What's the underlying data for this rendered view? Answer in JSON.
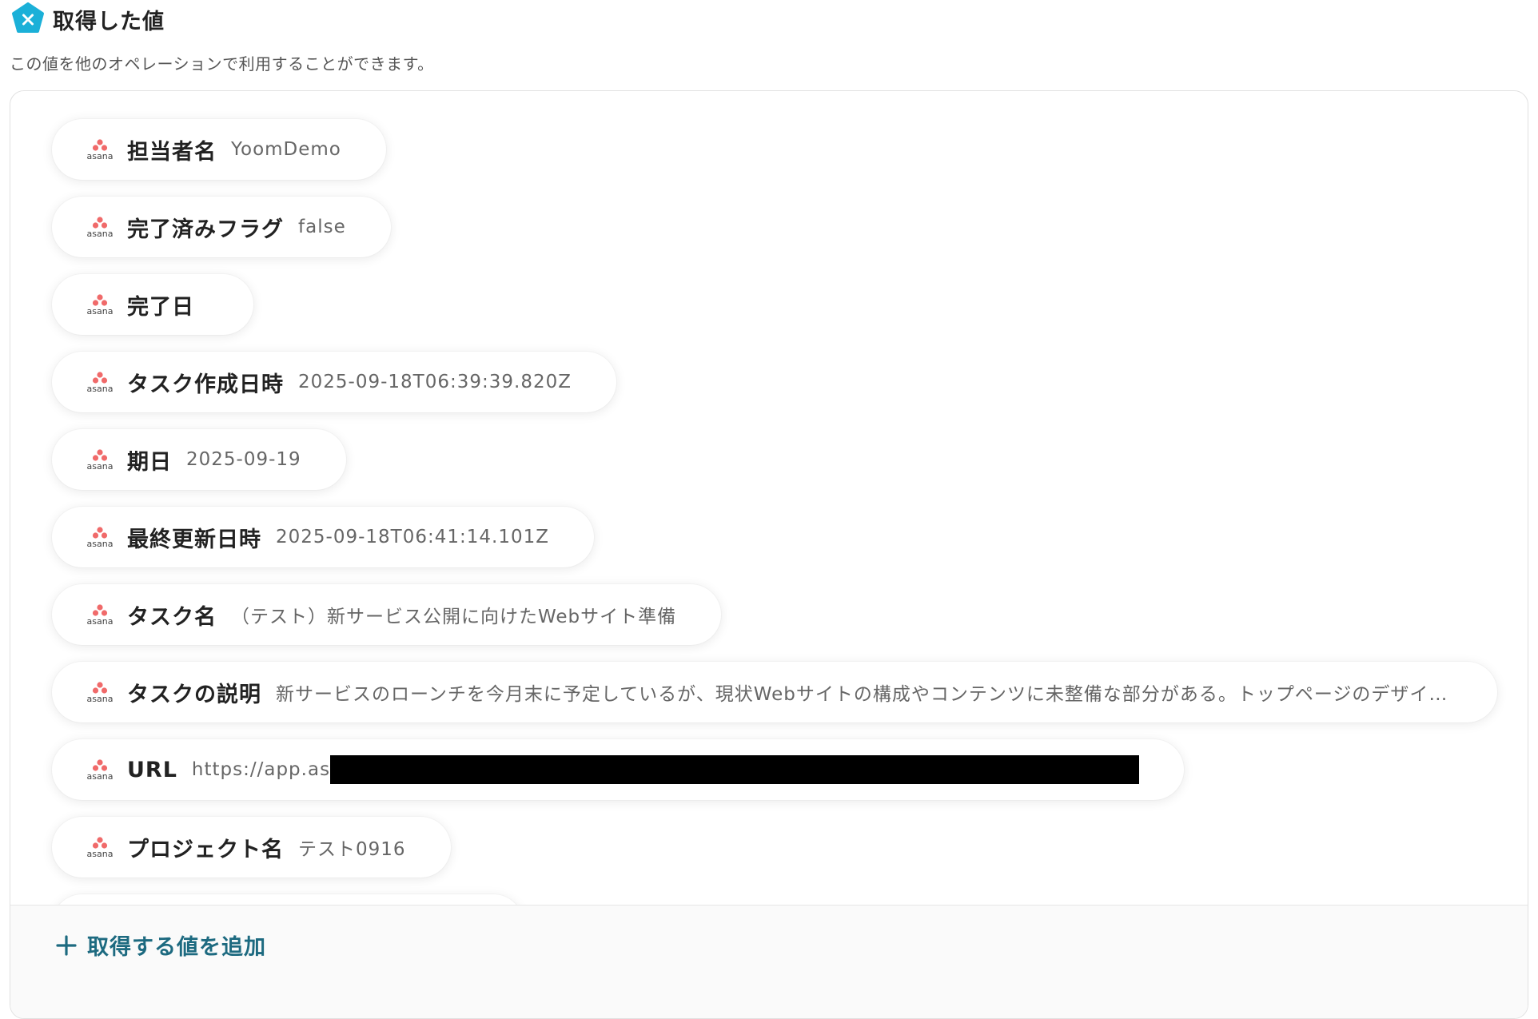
{
  "header": {
    "title": "取得した値",
    "subtitle": "この値を他のオペレーションで利用することができます。",
    "icon": "variable-x-icon"
  },
  "colors": {
    "accent": "#1d6a80",
    "header_icon": "#1bb0d8",
    "asana": "#f06a6a"
  },
  "items": [
    {
      "label": "担当者名",
      "value": "YoomDemo",
      "icon": "asana-logo"
    },
    {
      "label": "完了済みフラグ",
      "value": "false",
      "icon": "asana-logo"
    },
    {
      "label": "完了日",
      "value": "",
      "icon": "asana-logo"
    },
    {
      "label": "タスク作成日時",
      "value": "2025-09-18T06:39:39.820Z",
      "icon": "asana-logo"
    },
    {
      "label": "期日",
      "value": "2025-09-19",
      "icon": "asana-logo"
    },
    {
      "label": "最終更新日時",
      "value": "2025-09-18T06:41:14.101Z",
      "icon": "asana-logo"
    },
    {
      "label": "タスク名",
      "value": "（テスト）新サービス公開に向けたWebサイト準備",
      "icon": "asana-logo"
    },
    {
      "label": "タスクの説明",
      "value": "新サービスのローンチを今月末に予定しているが、現状Webサイトの構成やコンテンツに未整備な部分がある。トップページのデザインは...",
      "icon": "asana-logo"
    },
    {
      "label": "URL",
      "value": "https://app.as",
      "icon": "asana-logo"
    },
    {
      "label": "プロジェクト名",
      "value": "テスト0916",
      "icon": "asana-logo"
    }
  ],
  "footer": {
    "add_label": "取得する値を追加",
    "icon": "plus-icon"
  }
}
